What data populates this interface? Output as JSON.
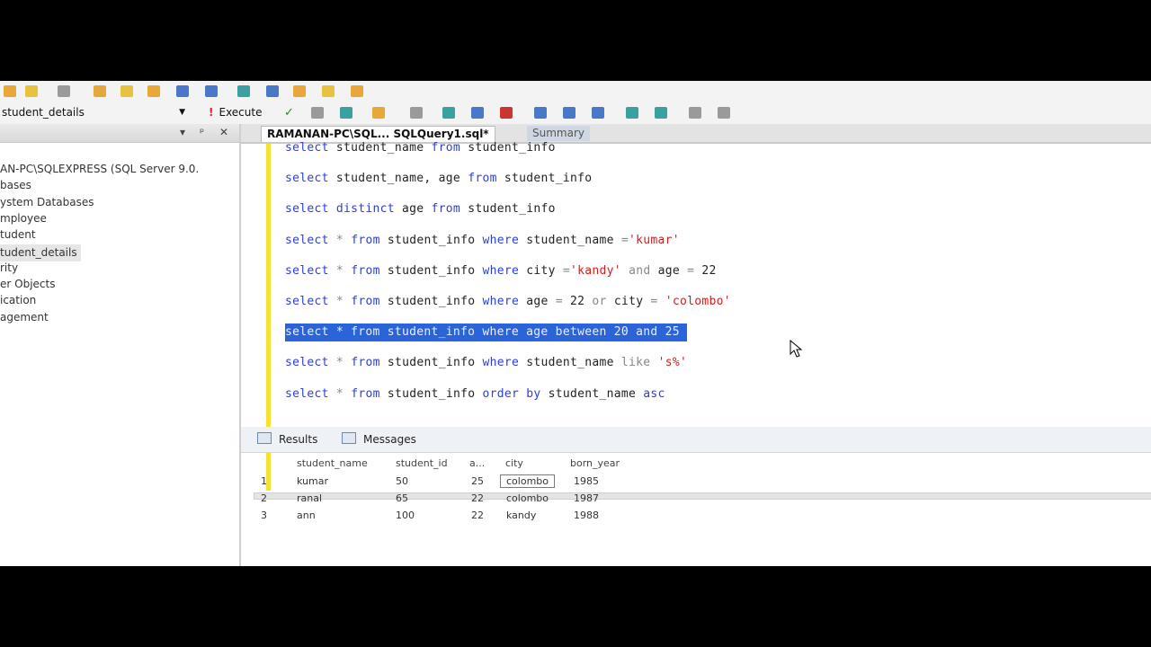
{
  "toolbar": {
    "database": "student_details",
    "execute_label": "Execute"
  },
  "explorer": {
    "nodes": [
      "AN-PC\\SQLEXPRESS (SQL Server 9.0.",
      "bases",
      "ystem Databases",
      "mployee",
      "tudent",
      "tudent_details",
      "rity",
      "er Objects",
      "ication",
      "agement"
    ]
  },
  "tabs": {
    "active": "RAMANAN-PC\\SQL... SQLQuery1.sql*",
    "summary": "Summary"
  },
  "code_lines": [
    "select student_name from student_info",
    "select student_name, age from student_info",
    "select distinct age from student_info",
    "select * from student_info where student_name ='kumar'",
    "select * from student_info where city ='kandy' and age = 22",
    "select * from student_info where age = 22 or city = 'colombo'",
    "select * from student_info where age between 20 and 25",
    "select * from student_info where student_name like 's%'",
    "select * from student_info order by student_name asc"
  ],
  "results": {
    "tab_results": "Results",
    "tab_messages": "Messages",
    "columns": [
      "student_name",
      "student_id",
      "a...",
      "city",
      "born_year"
    ],
    "rows": [
      {
        "n": "1",
        "cells": [
          "kumar",
          "50",
          "25",
          "colombo",
          "1985"
        ]
      },
      {
        "n": "2",
        "cells": [
          "ranal",
          "65",
          "22",
          "colombo",
          "1987"
        ]
      },
      {
        "n": "3",
        "cells": [
          "ann",
          "100",
          "22",
          "kandy",
          "1988"
        ]
      }
    ]
  },
  "colors": {
    "keyword": "#2b3fd8",
    "string": "#d21d1d",
    "selection": "#2a64d8",
    "margin": "#f5e233"
  }
}
